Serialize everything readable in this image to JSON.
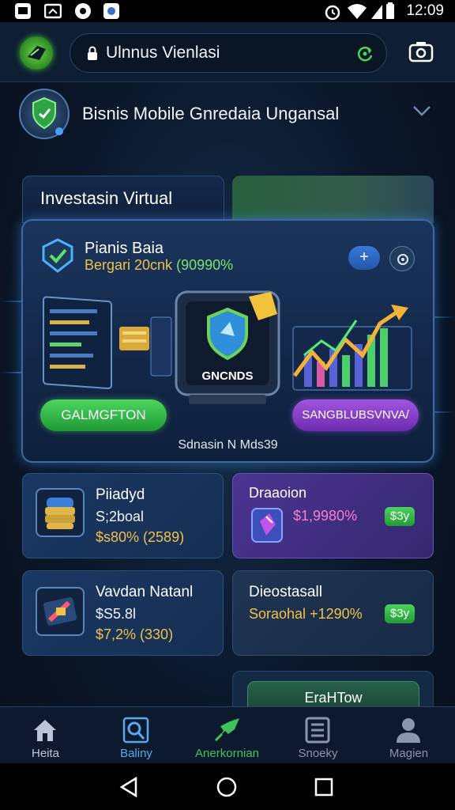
{
  "status_bar": {
    "time": "12:09"
  },
  "browser": {
    "url": "Ulnnus Vienlasi"
  },
  "header": {
    "title": "Bisnis Mobile  Gnredaia Ungansal"
  },
  "tabs": {
    "virtual": "Investasin Virtual"
  },
  "main_card": {
    "title": "Pianis Baia",
    "sub_a": "Bergari 20cnk",
    "sub_b": "(90990%",
    "plus_label": "+",
    "device_label": "GNCNDS",
    "left_button": "GALMGFTON",
    "right_button": "SANGBLUBSVNVA/",
    "footnote": "Sdnasin N Mds39"
  },
  "cards": [
    {
      "name": "Piiadyd",
      "line2": "S;2boal",
      "line3": "$s80% (2589)"
    },
    {
      "name": "Draaoion",
      "line2": "$1,9980%",
      "pill": "$3y"
    },
    {
      "name": "Vavdan Natanl",
      "line2": "$S5.8l",
      "line3": "$7,2% (330)"
    },
    {
      "name": "Dieostasall",
      "line2_a": "Soraohal",
      "line2_b": "+1290%",
      "pill": "$3y"
    }
  ],
  "partial_button": "EraHTow",
  "tab_bar": [
    {
      "label": "Heita",
      "color": "#b8c6d8"
    },
    {
      "label": "Baliny",
      "color": "#5aa9ee"
    },
    {
      "label": "Anerkornian",
      "color": "#3fc45a"
    },
    {
      "label": "Snoeky",
      "color": "#8a97aa"
    },
    {
      "label": "Magien",
      "color": "#8a97aa"
    }
  ],
  "icons": [
    "app-icon-1",
    "app-icon-2",
    "app-icon-3",
    "app-icon-4",
    "alarm-icon",
    "wifi-icon",
    "signal-icon",
    "battery-icon",
    "lock-icon",
    "reload-icon",
    "camera-icon",
    "shield-icon",
    "chevron-down-icon",
    "check-icon",
    "plus-icon",
    "settings-icon",
    "home-icon",
    "search-icon",
    "rocket-icon",
    "document-icon",
    "person-icon",
    "back-icon",
    "home-nav-icon",
    "recents-icon"
  ]
}
